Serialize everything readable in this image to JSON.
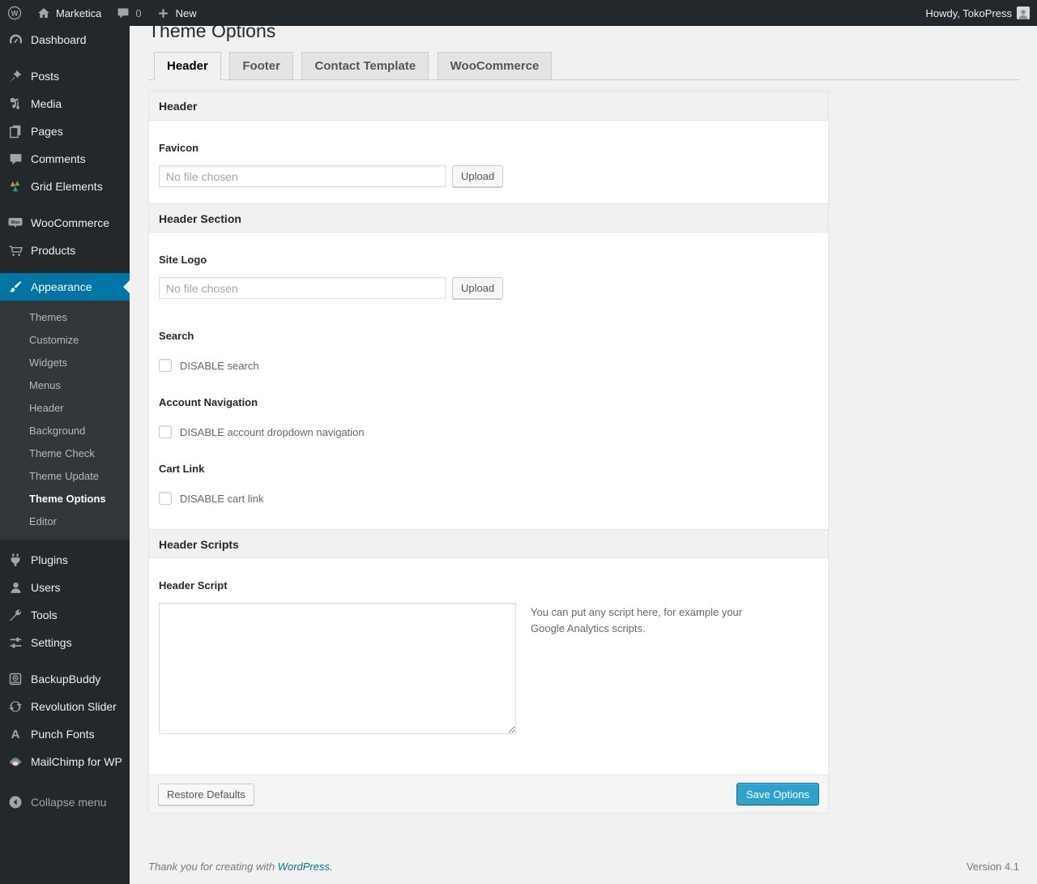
{
  "colors": {
    "admin_bar_bg": "#23282d",
    "sidebar_bg": "#23282d",
    "submenu_bg": "#32373c",
    "highlight_blue": "#0074a2",
    "primary_button": "#2ea2cc",
    "content_bg": "#f1f1f1"
  },
  "admin_bar": {
    "site_name": "Marketica",
    "comment_count": "0",
    "new_label": "New",
    "howdy_text": "Howdy, TokoPress"
  },
  "sidebar": {
    "top_items": [
      {
        "label": "Dashboard"
      },
      {
        "label": "Posts"
      },
      {
        "label": "Media"
      },
      {
        "label": "Pages"
      },
      {
        "label": "Comments"
      },
      {
        "label": "Grid Elements"
      }
    ],
    "commerce_items": [
      {
        "label": "WooCommerce"
      },
      {
        "label": "Products"
      }
    ],
    "appearance": {
      "label": "Appearance",
      "submenu": [
        "Themes",
        "Customize",
        "Widgets",
        "Menus",
        "Header",
        "Background",
        "Theme Check",
        "Theme Update",
        "Theme Options",
        "Editor"
      ]
    },
    "lower_items": [
      {
        "label": "Plugins"
      },
      {
        "label": "Users"
      },
      {
        "label": "Tools"
      },
      {
        "label": "Settings"
      }
    ],
    "plugin_items": [
      {
        "label": "BackupBuddy"
      },
      {
        "label": "Revolution Slider"
      },
      {
        "label": "Punch Fonts"
      },
      {
        "label": "MailChimp for WP"
      }
    ],
    "collapse_label": "Collapse menu"
  },
  "page": {
    "title": "Theme Options",
    "tabs": [
      {
        "label": "Header"
      },
      {
        "label": "Footer"
      },
      {
        "label": "Contact Template"
      },
      {
        "label": "WooCommerce"
      }
    ]
  },
  "form": {
    "sections": {
      "header": "Header",
      "header_section": "Header Section",
      "header_scripts": "Header Scripts"
    },
    "favicon": {
      "label": "Favicon",
      "placeholder": "No file chosen",
      "button": "Upload"
    },
    "site_logo": {
      "label": "Site Logo",
      "placeholder": "No file chosen",
      "button": "Upload"
    },
    "search": {
      "label": "Search",
      "checkbox": "DISABLE search"
    },
    "account_nav": {
      "label": "Account Navigation",
      "checkbox": "DISABLE account dropdown navigation"
    },
    "cart_link": {
      "label": "Cart Link",
      "checkbox": "DISABLE cart link"
    },
    "header_script": {
      "label": "Header Script",
      "help": "You can put any script here, for example your Google Analytics scripts."
    },
    "actions": {
      "restore": "Restore Defaults",
      "save": "Save Options"
    }
  },
  "footer": {
    "thanks_prefix": "Thank you for creating with ",
    "thanks_link": "WordPress.",
    "version": "Version 4.1"
  }
}
